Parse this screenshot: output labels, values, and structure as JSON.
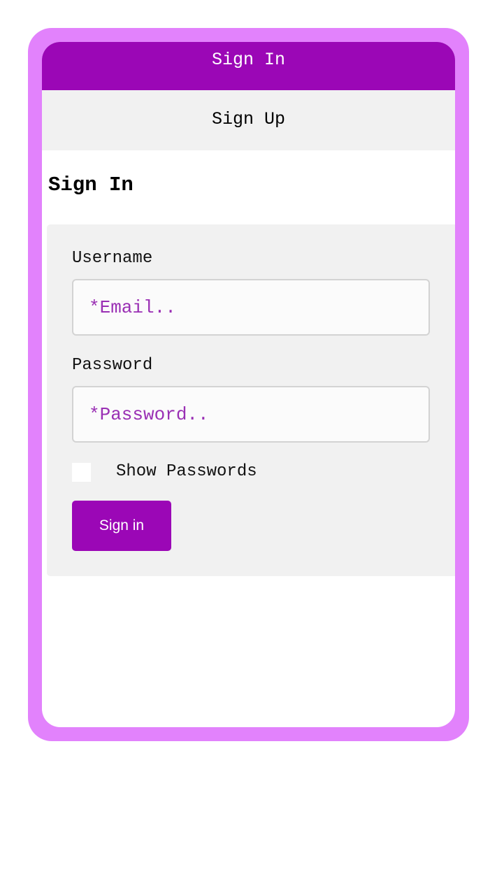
{
  "tabs": {
    "sign_in": "Sign In",
    "sign_up": "Sign Up"
  },
  "page": {
    "title": "Sign In"
  },
  "form": {
    "username_label": "Username",
    "username_placeholder": "*Email..",
    "username_value": "",
    "password_label": "Password",
    "password_placeholder": "*Password..",
    "password_value": "",
    "show_passwords_label": "Show Passwords",
    "show_passwords_checked": false,
    "submit_label": "Sign in"
  },
  "colors": {
    "frame": "#e282fc",
    "accent": "#9b07b6",
    "panel": "#f1f1f1",
    "placeholder": "#9a30b4"
  }
}
